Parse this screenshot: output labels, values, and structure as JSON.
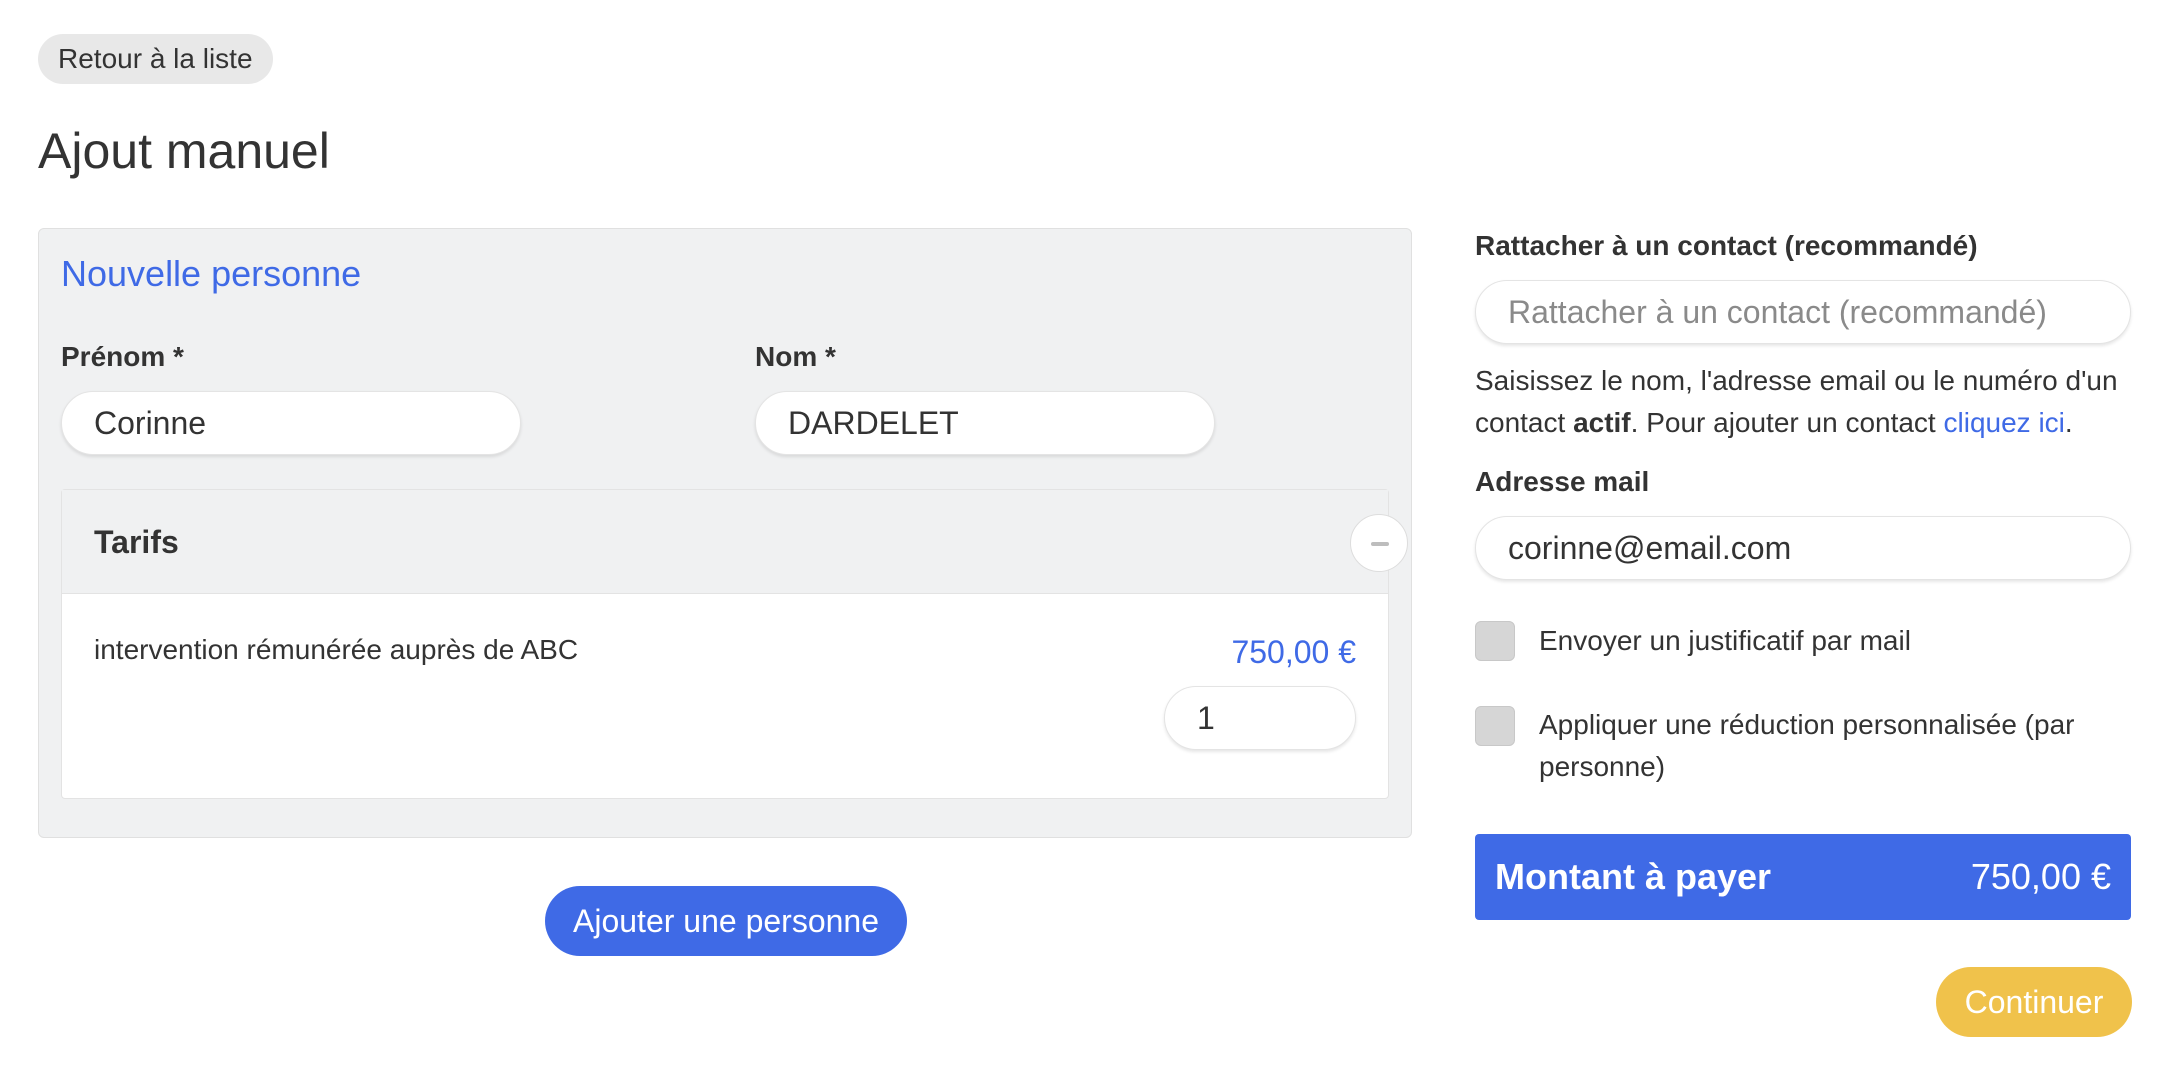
{
  "nav": {
    "back_label": "Retour à la liste"
  },
  "page": {
    "title": "Ajout manuel"
  },
  "person": {
    "panel_title": "Nouvelle personne",
    "first_name_label": "Prénom *",
    "first_name_value": "Corinne",
    "last_name_label": "Nom *",
    "last_name_value": "DARDELET"
  },
  "tarifs": {
    "title": "Tarifs",
    "items": [
      {
        "label": "intervention rémunérée auprès de ABC",
        "price": "750,00 €",
        "quantity": "1"
      }
    ]
  },
  "add_person_label": "Ajouter une personne",
  "contact": {
    "label": "Rattacher à un contact (recommandé)",
    "placeholder": "Rattacher à un contact (recommandé)",
    "help_before": "Saisissez le nom, l'adresse email ou le numéro d'un contact ",
    "help_bold": "actif",
    "help_middle": ". Pour ajouter un contact ",
    "help_link": "cliquez ici",
    "help_end": "."
  },
  "email": {
    "label": "Adresse mail",
    "value": "corinne@email.com"
  },
  "options": {
    "send_receipt": "Envoyer un justificatif par mail",
    "custom_discount": "Appliquer une réduction personnalisée (par personne)"
  },
  "total": {
    "label": "Montant à payer",
    "value": "750,00 €"
  },
  "continue_label": "Continuer",
  "colors": {
    "primary": "#3f6ae6",
    "accent": "#f0c24b",
    "panel": "#f0f1f2"
  }
}
